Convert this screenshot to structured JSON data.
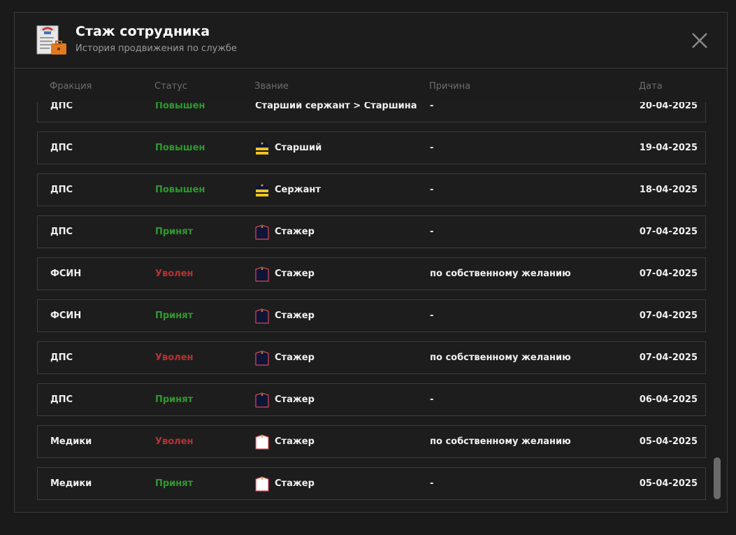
{
  "header": {
    "title": "Стаж сотрудника",
    "subtitle": "История продвижения по службе",
    "icon": "document-briefcase-icon",
    "close_icon": "close-icon"
  },
  "columns": {
    "faction": "Фракция",
    "status": "Статус",
    "rank": "Звание",
    "reason": "Причина",
    "date": "Дата"
  },
  "colors": {
    "promoted": "#2e9a2e",
    "accepted": "#2e9a2e",
    "fired": "#b83232",
    "stripe_gold": "#f2c31c",
    "trainee_dark": "#0e1537",
    "trainee_border": "#d24b5a"
  },
  "rows": [
    {
      "faction": "ДПС",
      "status": "Повышен",
      "status_kind": "green",
      "rank_icon": "none",
      "rank": "Старший сержант > Старшина",
      "reason": "-",
      "date": "20-04-2025"
    },
    {
      "faction": "ДПС",
      "status": "Повышен",
      "status_kind": "green",
      "rank_icon": "shoulder-strap-gold-icon",
      "rank": "Старший",
      "reason": "-",
      "date": "19-04-2025"
    },
    {
      "faction": "ДПС",
      "status": "Повышен",
      "status_kind": "green",
      "rank_icon": "shoulder-strap-gold-icon",
      "rank": "Сержант",
      "reason": "-",
      "date": "18-04-2025"
    },
    {
      "faction": "ДПС",
      "status": "Принят",
      "status_kind": "green",
      "rank_icon": "shoulder-strap-dark-icon",
      "rank": "Стажер",
      "reason": "-",
      "date": "07-04-2025"
    },
    {
      "faction": "ФСИН",
      "status": "Уволен",
      "status_kind": "red",
      "rank_icon": "shoulder-strap-dark-icon",
      "rank": "Стажер",
      "reason": "по собственному желанию",
      "date": "07-04-2025"
    },
    {
      "faction": "ФСИН",
      "status": "Принят",
      "status_kind": "green",
      "rank_icon": "shoulder-strap-dark-icon",
      "rank": "Стажер",
      "reason": "-",
      "date": "07-04-2025"
    },
    {
      "faction": "ДПС",
      "status": "Уволен",
      "status_kind": "red",
      "rank_icon": "shoulder-strap-dark-icon",
      "rank": "Стажер",
      "reason": "по собственному желанию",
      "date": "07-04-2025"
    },
    {
      "faction": "ДПС",
      "status": "Принят",
      "status_kind": "green",
      "rank_icon": "shoulder-strap-dark-icon",
      "rank": "Стажер",
      "reason": "-",
      "date": "06-04-2025"
    },
    {
      "faction": "Медики",
      "status": "Уволен",
      "status_kind": "red",
      "rank_icon": "shoulder-strap-white-icon",
      "rank": "Стажер",
      "reason": "по собственному желанию",
      "date": "05-04-2025"
    },
    {
      "faction": "Медики",
      "status": "Принят",
      "status_kind": "green",
      "rank_icon": "shoulder-strap-white-icon",
      "rank": "Стажер",
      "reason": "-",
      "date": "05-04-2025"
    }
  ]
}
